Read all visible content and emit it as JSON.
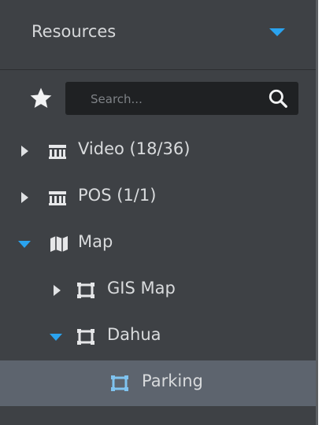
{
  "header": {
    "title": "Resources"
  },
  "search": {
    "placeholder": "Search..."
  },
  "tree": [
    {
      "label": "Video (18/36)",
      "icon": "device-group-icon",
      "expanded": false
    },
    {
      "label": "POS (1/1)",
      "icon": "device-group-icon",
      "expanded": false
    },
    {
      "label": "Map",
      "icon": "map-icon",
      "expanded": true
    },
    {
      "label": "GIS Map",
      "icon": "map-frame-icon",
      "expanded": false
    },
    {
      "label": "Dahua",
      "icon": "map-frame-icon",
      "expanded": true
    },
    {
      "label": "Parking",
      "icon": "map-frame-icon",
      "selected": true
    }
  ],
  "colors": {
    "panel": "#3e4145",
    "accent": "#2aa3ef",
    "selected_row": "#5d646e",
    "search_bg": "#1f2123"
  }
}
